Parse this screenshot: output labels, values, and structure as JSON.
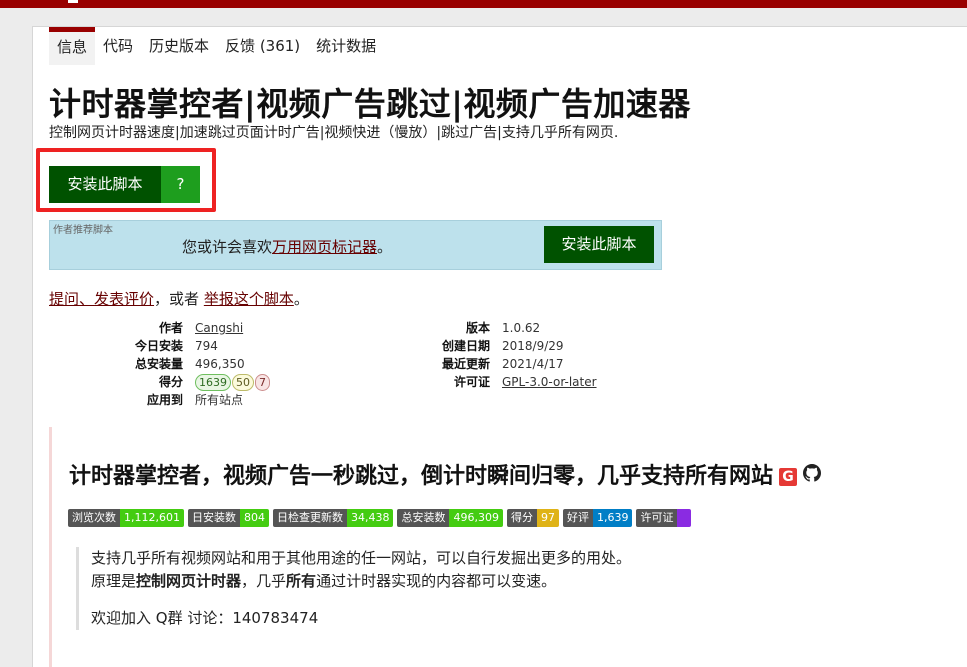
{
  "tabs": [
    {
      "label": "信息"
    },
    {
      "label": "代码"
    },
    {
      "label": "历史版本"
    },
    {
      "label": "反馈 (361)"
    },
    {
      "label": "统计数据"
    }
  ],
  "script": {
    "title": "计时器掌控者|视频广告跳过|视频广告加速器",
    "subtitle": "控制网页计时器速度|加速跳过页面计时广告|视频快进（慢放）|跳过广告|支持几乎所有网页.",
    "install_label": "安装此脚本",
    "install_help_label": "?"
  },
  "recommend": {
    "label": "作者推荐脚本",
    "text_prefix": "您或许会喜欢",
    "link": "万用网页标记器",
    "text_suffix": "。",
    "install_label": "安装此脚本"
  },
  "feedback": {
    "ask": "提问",
    "sep": "、",
    "review": "发表评价",
    "or": "，或者 ",
    "report": "举报这个脚本",
    "end": "。"
  },
  "meta_left": {
    "author_label": "作者",
    "author": "Cangshi",
    "daily_label": "今日安装",
    "daily": "794",
    "total_label": "总安装量",
    "total": "496,350",
    "rating_label": "得分",
    "rating_good": "1639",
    "rating_ok": "50",
    "rating_bad": "7",
    "applies_label": "应用到",
    "applies": "所有站点"
  },
  "meta_right": {
    "version_label": "版本",
    "version": "1.0.62",
    "created_label": "创建日期",
    "created": "2018/9/29",
    "updated_label": "最近更新",
    "updated": "2021/4/17",
    "license_label": "许可证",
    "license": "GPL-3.0-or-later"
  },
  "description": {
    "title": "计时器掌控者，视频广告一秒跳过，倒计时瞬间归零，几乎支持所有网站",
    "g_icon_letter": "G",
    "badges": [
      {
        "label": "浏览次数",
        "value": "1,112,601",
        "color": "#4c1"
      },
      {
        "label": "日安装数",
        "value": "804",
        "color": "#4c1"
      },
      {
        "label": "日检查更新数",
        "value": "34,438",
        "color": "#4c1"
      },
      {
        "label": "总安装数",
        "value": "496,309",
        "color": "#4c1"
      },
      {
        "label": "得分",
        "value": "97",
        "color": "#dfb317"
      },
      {
        "label": "好评",
        "value": "1,639",
        "color": "#007ec6"
      },
      {
        "label": "许可证",
        "value": "",
        "color": "#8a2be2"
      }
    ],
    "line1": "支持几乎所有视频网站和用于其他用途的任一网站，可以自行发掘出更多的用处。",
    "line2_a": "原理是",
    "line2_b": "控制网页计时器",
    "line2_c": "，几乎",
    "line2_d": "所有",
    "line2_e": "通过计时器实现的内容都可以变速。",
    "line3": "欢迎加入 Q群 讨论：140783474"
  }
}
